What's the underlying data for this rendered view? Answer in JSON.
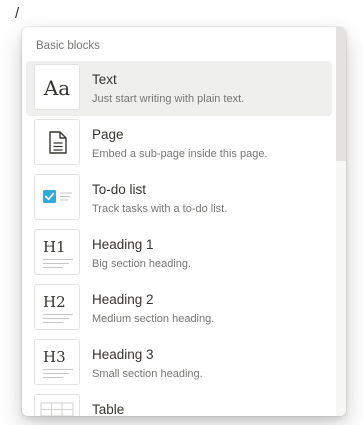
{
  "editor": {
    "slash_char": "/"
  },
  "menu": {
    "section_label": "Basic blocks",
    "items": [
      {
        "title": "Text",
        "description": "Just start writing with plain text.",
        "icon": "text-aa-icon",
        "glyph": "Aa",
        "active": true
      },
      {
        "title": "Page",
        "description": "Embed a sub-page inside this page.",
        "icon": "page-document-icon"
      },
      {
        "title": "To-do list",
        "description": "Track tasks with a to-do list.",
        "icon": "checkbox-icon"
      },
      {
        "title": "Heading 1",
        "description": "Big section heading.",
        "icon": "heading-1-icon",
        "glyph": "H1"
      },
      {
        "title": "Heading 2",
        "description": "Medium section heading.",
        "icon": "heading-2-icon",
        "glyph": "H2"
      },
      {
        "title": "Heading 3",
        "description": "Small section heading.",
        "icon": "heading-3-icon",
        "glyph": "H3"
      },
      {
        "title": "Table",
        "description": "",
        "icon": "table-grid-icon"
      }
    ]
  },
  "colors": {
    "text": "#37352f",
    "secondary_text": "#787774",
    "hover_bg": "#efefed",
    "checkbox_blue": "#2eaadc"
  }
}
